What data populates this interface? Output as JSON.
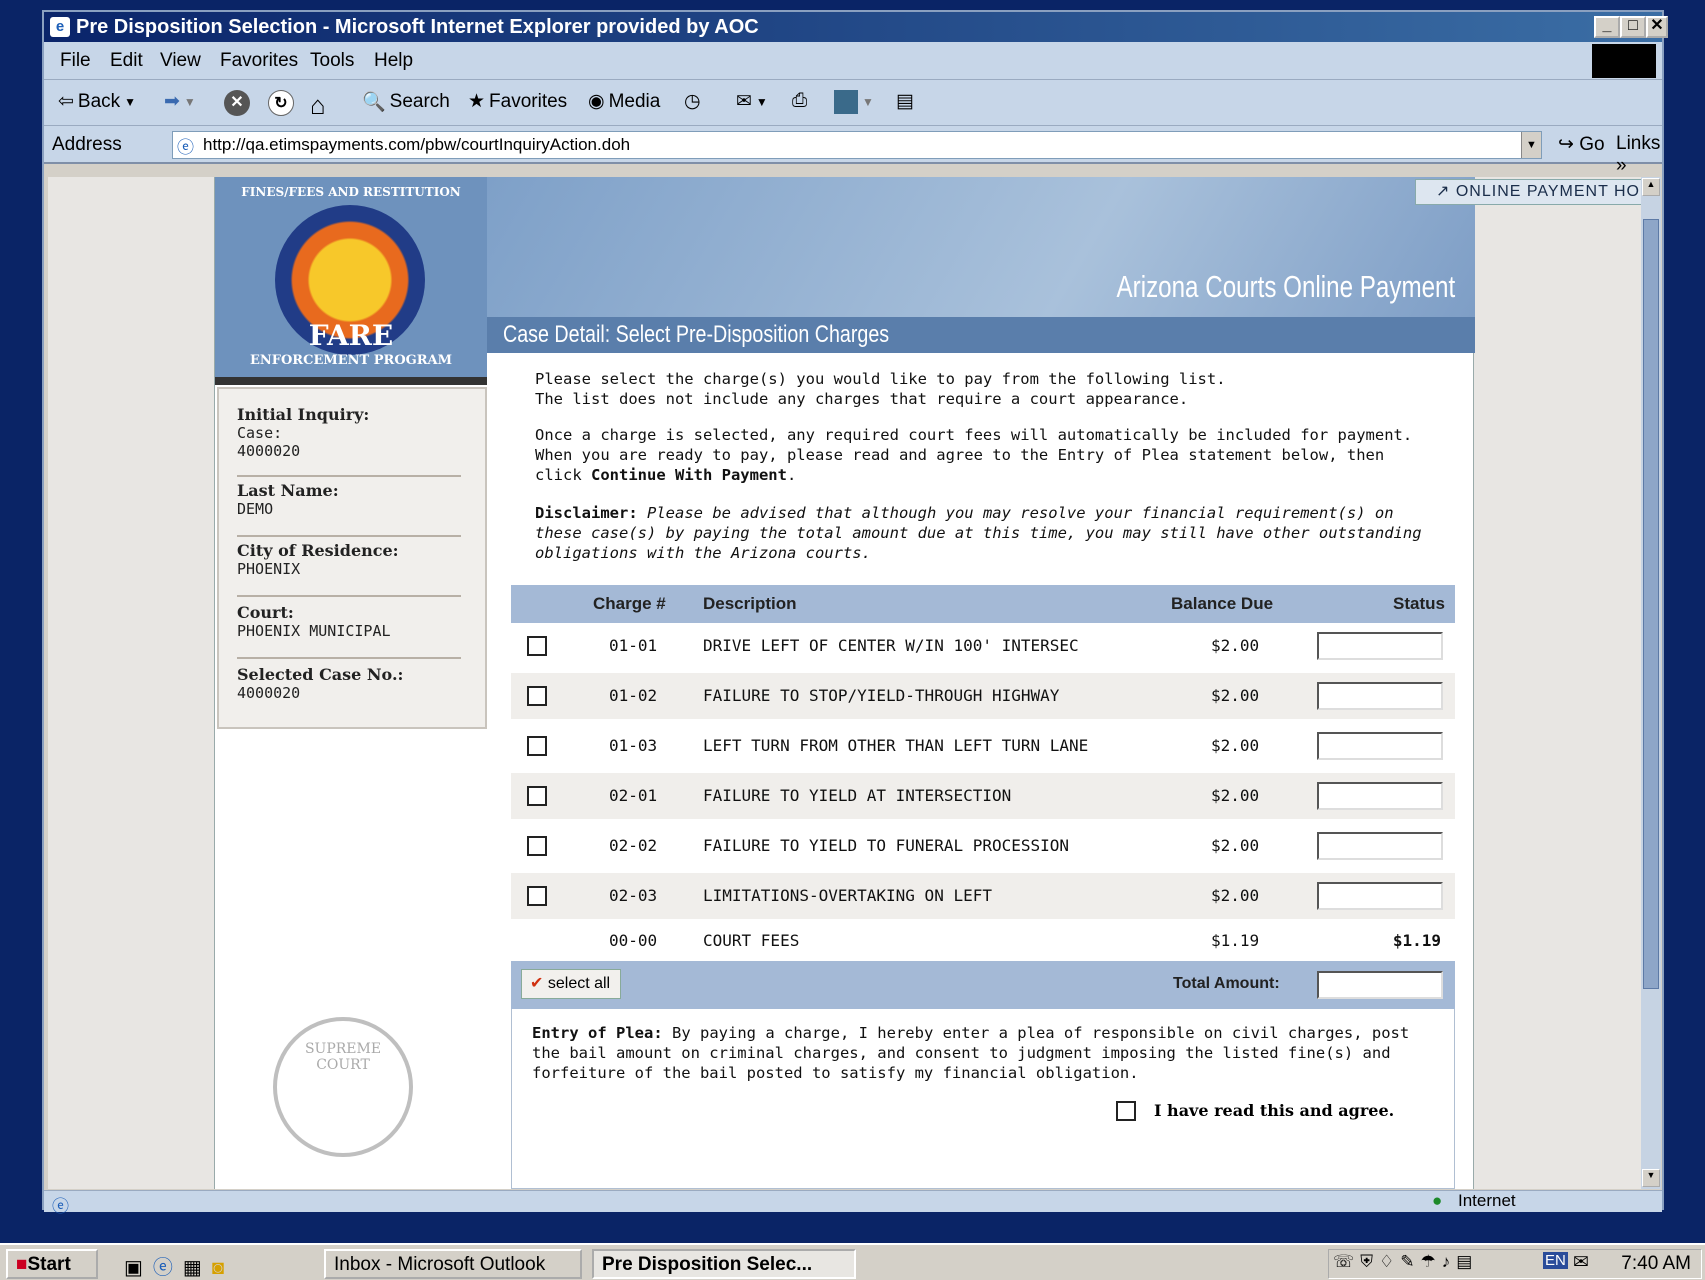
{
  "window": {
    "title": "Pre Disposition Selection - Microsoft Internet Explorer provided by AOC"
  },
  "menu": [
    "File",
    "Edit",
    "View",
    "Favorites",
    "Tools",
    "Help"
  ],
  "toolbar": {
    "back": "Back",
    "search": "Search",
    "favorites": "Favorites",
    "media": "Media"
  },
  "address": {
    "label": "Address",
    "url": "http://qa.etimspayments.com/pbw/courtInquiryAction.doh",
    "go": "Go",
    "links": "Links"
  },
  "header": {
    "home_link": "ONLINE PAYMENT HOME",
    "site_title": "Arizona Courts Online Payment",
    "section_title": "Case Detail: Select Pre-Disposition Charges",
    "logo": {
      "arc": "FINES/FEES AND RESTITUTION",
      "name": "FARE",
      "sub": "ENFORCEMENT PROGRAM"
    }
  },
  "sidebar": [
    {
      "label": "Initial Inquiry:",
      "value": "Case:\n4000020"
    },
    {
      "label": "Last Name:",
      "value": "DEMO"
    },
    {
      "label": "City of Residence:",
      "value": "PHOENIX"
    },
    {
      "label": "Court:",
      "value": "PHOENIX MUNICIPAL"
    },
    {
      "label": "Selected Case No.:",
      "value": "4000020"
    }
  ],
  "seal_text": "SUPREME COURT",
  "intro": {
    "p1a": "Please select the charge(s) you would like to pay from the following list.",
    "p1b": "The list does not include any charges that require a court appearance.",
    "p2": "Once a charge is selected, any required court fees will automatically be included for payment. When you are ready to pay, please read and agree to the Entry of Plea statement below, then click ",
    "p2b": "Continue With Payment",
    "disc_label": "Disclaimer:",
    "disc": "Please be advised that although you may resolve your financial requirement(s) on these case(s) by paying the total amount due at this time, you may still have other outstanding obligations with the Arizona courts."
  },
  "table": {
    "headers": {
      "charge": "Charge #",
      "desc": "Description",
      "balance": "Balance Due",
      "status": "Status"
    },
    "rows": [
      {
        "charge": "01-01",
        "desc": "DRIVE LEFT OF CENTER W/IN 100' INTERSEC",
        "balance": "$2.00"
      },
      {
        "charge": "01-02",
        "desc": "FAILURE TO STOP/YIELD-THROUGH HIGHWAY",
        "balance": "$2.00"
      },
      {
        "charge": "01-03",
        "desc": "LEFT TURN FROM OTHER THAN LEFT TURN LANE",
        "balance": "$2.00"
      },
      {
        "charge": "02-01",
        "desc": "FAILURE TO YIELD AT INTERSECTION",
        "balance": "$2.00"
      },
      {
        "charge": "02-02",
        "desc": "FAILURE TO YIELD TO FUNERAL PROCESSION",
        "balance": "$2.00"
      },
      {
        "charge": "02-03",
        "desc": "LIMITATIONS-OVERTAKING ON LEFT",
        "balance": "$2.00"
      }
    ],
    "fees": {
      "charge": "00-00",
      "desc": "COURT FEES",
      "balance": "$1.19",
      "status": "$1.19"
    },
    "select_all": "select all",
    "total_label": "Total Amount:"
  },
  "plea": {
    "label": "Entry of Plea:",
    "text": "By paying a charge, I hereby enter a plea of responsible on civil charges, post the bail amount on criminal charges, and consent to judgment imposing the listed fine(s) and forfeiture of the bail posted to satisfy my financial obligation.",
    "agree": "I have read this and agree."
  },
  "statusbar": {
    "zone": "Internet"
  },
  "taskbar": {
    "start": "Start",
    "task1": "Inbox - Microsoft Outlook",
    "task2": "Pre Disposition Selec...",
    "clock": "7:40 AM",
    "lang": "EN"
  }
}
